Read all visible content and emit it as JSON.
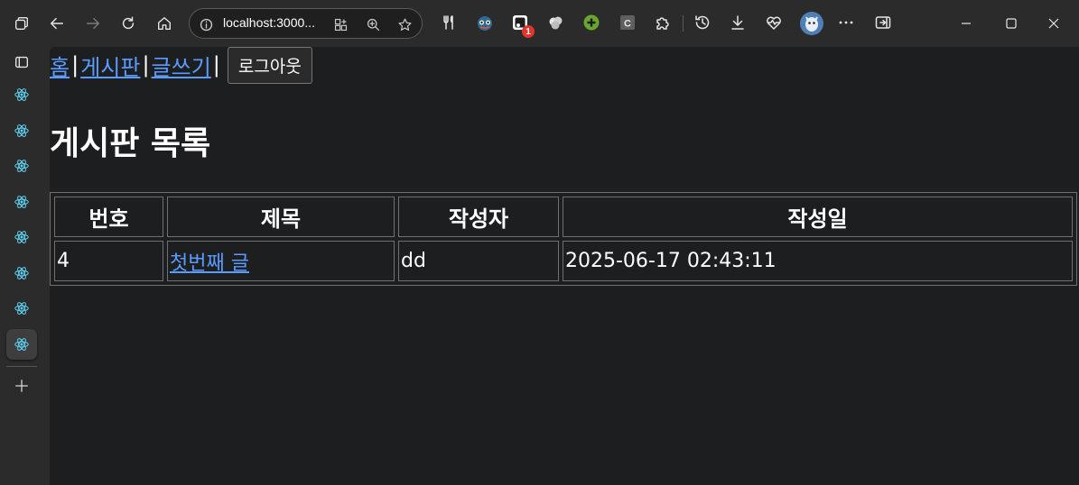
{
  "browser": {
    "address": "localhost:3000...",
    "extension_badge": "1",
    "accent_color": "#5a9bff"
  },
  "nav": {
    "items": [
      {
        "label": "홈"
      },
      {
        "label": "게시판"
      },
      {
        "label": "글쓰기"
      }
    ],
    "separator": "|",
    "logout_label": "로그아웃"
  },
  "page": {
    "title": "게시판 목록"
  },
  "table": {
    "headers": [
      "번호",
      "제목",
      "작성자",
      "작성일"
    ],
    "rows": [
      {
        "id": "4",
        "title": "첫번째 글",
        "author": "dd",
        "date": "2025-06-17 02:43:11"
      }
    ]
  },
  "sidebar": {
    "tab_icons": [
      "react-icon",
      "react-icon",
      "react-icon",
      "react-icon",
      "react-icon",
      "react-icon",
      "react-icon",
      "react-icon"
    ],
    "active_tab": 8
  }
}
